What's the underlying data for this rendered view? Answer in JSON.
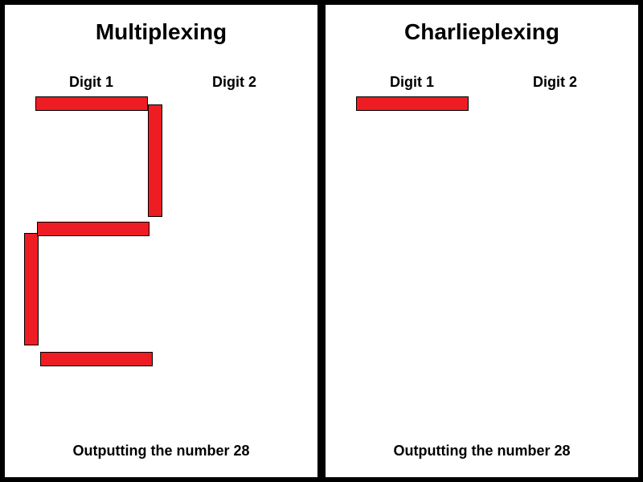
{
  "left": {
    "title": "Multiplexing",
    "digit1_label": "Digit 1",
    "digit2_label": "Digit 2",
    "caption": "Outputting the number 28",
    "digit1_segments": {
      "a": true,
      "b": true,
      "c": false,
      "d": true,
      "e": true,
      "f": false,
      "g": true
    },
    "digit2_segments": {
      "a": false,
      "b": false,
      "c": false,
      "d": false,
      "e": false,
      "f": false,
      "g": false
    }
  },
  "right": {
    "title": "Charlieplexing",
    "digit1_label": "Digit 1",
    "digit2_label": "Digit 2",
    "caption": "Outputting the number 28",
    "digit1_segments": {
      "a": true,
      "b": false,
      "c": false,
      "d": false,
      "e": false,
      "f": false,
      "g": false
    },
    "digit2_segments": {
      "a": false,
      "b": false,
      "c": false,
      "d": false,
      "e": false,
      "f": false,
      "g": false
    }
  },
  "colors": {
    "segment_on": "#ee1c23"
  }
}
